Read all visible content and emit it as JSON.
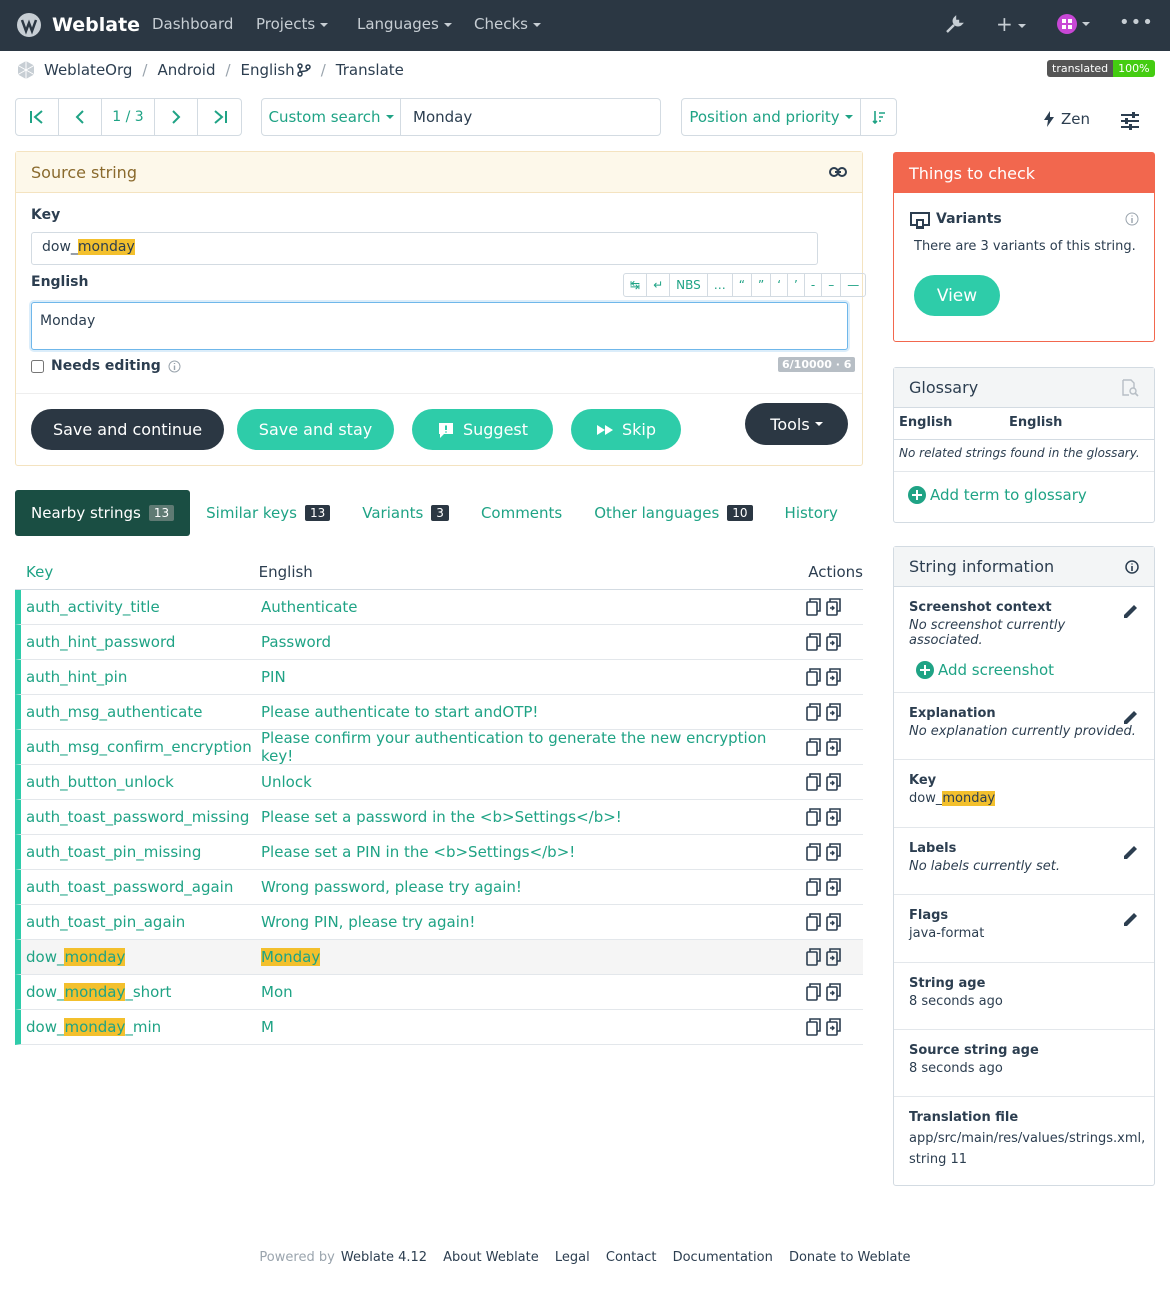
{
  "nav": {
    "brand": "Weblate",
    "items": [
      "Dashboard",
      "Projects",
      "Languages",
      "Checks"
    ],
    "colors": {
      "bg": "#2b3743",
      "accent": "#2ecca9"
    }
  },
  "breadcrumb": [
    "WeblateOrg",
    "Android",
    "English",
    "Translate"
  ],
  "status_badge": {
    "label": "translated",
    "value": "100%"
  },
  "pager": {
    "position": "1 / 3"
  },
  "search": {
    "mode": "Custom search",
    "query": "Monday"
  },
  "sort": {
    "label": "Position and priority"
  },
  "zen": "Zen",
  "source": {
    "title": "Source string",
    "key_label": "Key",
    "key_prefix": "dow_",
    "key_highlight": "monday",
    "lang_label": "English",
    "special_chars": [
      "↹",
      "↵",
      "NBS",
      "…",
      "“",
      "”",
      "‘",
      "’",
      "-",
      "–",
      "—"
    ],
    "value": "Monday",
    "needs_editing": "Needs editing",
    "counter": "6/10000 · 6"
  },
  "buttons": {
    "save_continue": "Save and continue",
    "save_stay": "Save and stay",
    "suggest": "Suggest",
    "skip": "Skip",
    "tools": "Tools"
  },
  "tabs": [
    {
      "label": "Nearby strings",
      "count": "13"
    },
    {
      "label": "Similar keys",
      "count": "13"
    },
    {
      "label": "Variants",
      "count": "3"
    },
    {
      "label": "Comments",
      "count": ""
    },
    {
      "label": "Other languages",
      "count": "10"
    },
    {
      "label": "History",
      "count": ""
    }
  ],
  "table": {
    "headers": [
      "Key",
      "English",
      "Actions"
    ],
    "rows": [
      {
        "key": "auth_activity_title",
        "text": "Authenticate"
      },
      {
        "key": "auth_hint_password",
        "text": "Password"
      },
      {
        "key": "auth_hint_pin",
        "text": "PIN"
      },
      {
        "key": "auth_msg_authenticate",
        "text": "Please authenticate to start andOTP!"
      },
      {
        "key": "auth_msg_confirm_encryption",
        "text": "Please confirm your authentication to generate the new encryption key!"
      },
      {
        "key": "auth_button_unlock",
        "text": "Unlock"
      },
      {
        "key": "auth_toast_password_missing",
        "text": "Please set a password in the <b>Settings</b>!"
      },
      {
        "key": "auth_toast_pin_missing",
        "text": "Please set a PIN in the <b>Settings</b>!"
      },
      {
        "key": "auth_toast_password_again",
        "text": "Wrong password, please try again!"
      },
      {
        "key": "auth_toast_pin_again",
        "text": "Wrong PIN, please try again!"
      }
    ],
    "hl_rows": [
      {
        "pre": "dow_",
        "hl": "monday",
        "post": "",
        "text": "Monday",
        "text_hl": true
      },
      {
        "pre": "dow_",
        "hl": "monday",
        "post": "_short",
        "text": "Mon",
        "text_hl": false
      },
      {
        "pre": "dow_",
        "hl": "monday",
        "post": "_min",
        "text": "M",
        "text_hl": false
      }
    ]
  },
  "checks": {
    "title": "Things to check",
    "item_title": "Variants",
    "item_text": "There are 3 variants of this string.",
    "view": "View"
  },
  "glossary": {
    "title": "Glossary",
    "col1": "English",
    "col2": "English",
    "empty": "No related strings found in the glossary.",
    "add": "Add term to glossary"
  },
  "info": {
    "title": "String information",
    "screenshot_t": "Screenshot context",
    "screenshot_v": "No screenshot currently associated.",
    "add_screenshot": "Add screenshot",
    "explanation_t": "Explanation",
    "explanation_v": "No explanation currently provided.",
    "key_t": "Key",
    "key_pre": "dow_",
    "key_hl": "monday",
    "labels_t": "Labels",
    "labels_v": "No labels currently set.",
    "flags_t": "Flags",
    "flags_v": "java-format",
    "age_t": "String age",
    "age_v": "8 seconds ago",
    "src_age_t": "Source string age",
    "src_age_v": "8 seconds ago",
    "file_t": "Translation file",
    "file_v": "app/src/main/res/values/strings.xml, string 11"
  },
  "footer": {
    "powered": "Powered by",
    "version": "Weblate 4.12",
    "links": [
      "About Weblate",
      "Legal",
      "Contact",
      "Documentation",
      "Donate to Weblate"
    ]
  }
}
